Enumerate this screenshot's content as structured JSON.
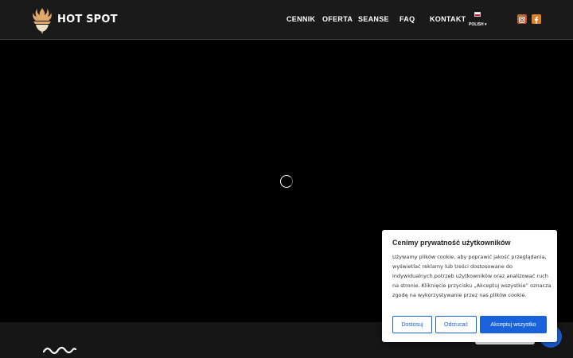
{
  "header": {
    "brand": "HOT SPOT",
    "nav": [
      "CENNIK",
      "OFERTA",
      "SEANSE",
      "FAQ",
      "KONTAKT"
    ],
    "language": "POLISH",
    "social_icons": [
      "instagram-icon",
      "facebook-icon"
    ]
  },
  "cookie": {
    "title": "Cenimy prywatność użytkowników",
    "text": "Używamy plików cookie, aby poprawić jakość przeglądania, wyświetlać reklamy lub treści dostosowane do indywidualnych potrzeb użytkowników oraz analizować ruch na stronie. Kliknięcie przycisku „Akceptuj wszystkie” oznacza zgodę na wykorzystywanie przez nas plików cookie.",
    "btn_customize": "Dostosuj",
    "btn_reject": "Odrzucać",
    "btn_accept": "Akceptuj wszystko"
  },
  "colors": {
    "header_bg": "#1a1a1a",
    "accent_orange": "#d9822b",
    "button_blue": "#1863dc"
  }
}
